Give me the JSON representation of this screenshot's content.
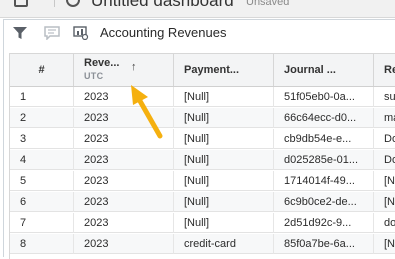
{
  "topbar": {
    "title": "Untitled dashboard",
    "status": "Unsaved"
  },
  "panel": {
    "title": "Accounting Revenues",
    "toolbar_icons": [
      "filter-icon",
      "comment-icon",
      "visualization-icon"
    ]
  },
  "table": {
    "headers": {
      "num": "#",
      "revenue": "Reve...",
      "revenue_sub": "UTC",
      "revenue_sort": "↑",
      "payment": "Payment...",
      "journal": "Journal ...",
      "rev2": "Rev"
    },
    "rows": [
      {
        "num": "1",
        "revenue": "2023",
        "payment": "[Null]",
        "journal": "51f05eb0-0a...",
        "rev2": "sup"
      },
      {
        "num": "2",
        "revenue": "2023",
        "payment": "[Null]",
        "journal": "66c64ecc-d0...",
        "rev2": "ma"
      },
      {
        "num": "3",
        "revenue": "2023",
        "payment": "[Null]",
        "journal": "cb9db54e-e...",
        "rev2": "Dor"
      },
      {
        "num": "4",
        "revenue": "2023",
        "payment": "[Null]",
        "journal": "d025285e-01...",
        "rev2": "Dor"
      },
      {
        "num": "5",
        "revenue": "2023",
        "payment": "[Null]",
        "journal": "1714014f-49...",
        "rev2": "[Nu"
      },
      {
        "num": "6",
        "revenue": "2023",
        "payment": "[Null]",
        "journal": "6c9b0ce2-de...",
        "rev2": "[Nu"
      },
      {
        "num": "7",
        "revenue": "2023",
        "payment": "[Null]",
        "journal": "2d51d92c-9...",
        "rev2": "dor"
      },
      {
        "num": "8",
        "revenue": "2023",
        "payment": "credit-card",
        "journal": "85f0a7be-6a...",
        "rev2": "[Nu"
      }
    ]
  },
  "colors": {
    "annotation_arrow": "#f5b00f",
    "header_bg": "#f3f4f5",
    "alt_row_bg": "#f7f8f9"
  }
}
